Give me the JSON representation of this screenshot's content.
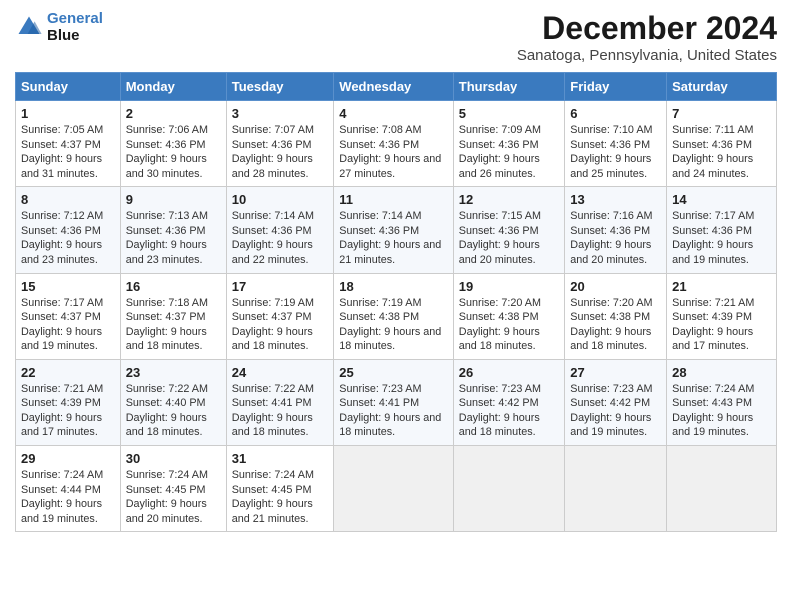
{
  "logo": {
    "line1": "General",
    "line2": "Blue"
  },
  "title": "December 2024",
  "subtitle": "Sanatoga, Pennsylvania, United States",
  "days_header": [
    "Sunday",
    "Monday",
    "Tuesday",
    "Wednesday",
    "Thursday",
    "Friday",
    "Saturday"
  ],
  "weeks": [
    [
      {
        "day": "1",
        "sunrise": "Sunrise: 7:05 AM",
        "sunset": "Sunset: 4:37 PM",
        "daylight": "Daylight: 9 hours and 31 minutes."
      },
      {
        "day": "2",
        "sunrise": "Sunrise: 7:06 AM",
        "sunset": "Sunset: 4:36 PM",
        "daylight": "Daylight: 9 hours and 30 minutes."
      },
      {
        "day": "3",
        "sunrise": "Sunrise: 7:07 AM",
        "sunset": "Sunset: 4:36 PM",
        "daylight": "Daylight: 9 hours and 28 minutes."
      },
      {
        "day": "4",
        "sunrise": "Sunrise: 7:08 AM",
        "sunset": "Sunset: 4:36 PM",
        "daylight": "Daylight: 9 hours and 27 minutes."
      },
      {
        "day": "5",
        "sunrise": "Sunrise: 7:09 AM",
        "sunset": "Sunset: 4:36 PM",
        "daylight": "Daylight: 9 hours and 26 minutes."
      },
      {
        "day": "6",
        "sunrise": "Sunrise: 7:10 AM",
        "sunset": "Sunset: 4:36 PM",
        "daylight": "Daylight: 9 hours and 25 minutes."
      },
      {
        "day": "7",
        "sunrise": "Sunrise: 7:11 AM",
        "sunset": "Sunset: 4:36 PM",
        "daylight": "Daylight: 9 hours and 24 minutes."
      }
    ],
    [
      {
        "day": "8",
        "sunrise": "Sunrise: 7:12 AM",
        "sunset": "Sunset: 4:36 PM",
        "daylight": "Daylight: 9 hours and 23 minutes."
      },
      {
        "day": "9",
        "sunrise": "Sunrise: 7:13 AM",
        "sunset": "Sunset: 4:36 PM",
        "daylight": "Daylight: 9 hours and 23 minutes."
      },
      {
        "day": "10",
        "sunrise": "Sunrise: 7:14 AM",
        "sunset": "Sunset: 4:36 PM",
        "daylight": "Daylight: 9 hours and 22 minutes."
      },
      {
        "day": "11",
        "sunrise": "Sunrise: 7:14 AM",
        "sunset": "Sunset: 4:36 PM",
        "daylight": "Daylight: 9 hours and 21 minutes."
      },
      {
        "day": "12",
        "sunrise": "Sunrise: 7:15 AM",
        "sunset": "Sunset: 4:36 PM",
        "daylight": "Daylight: 9 hours and 20 minutes."
      },
      {
        "day": "13",
        "sunrise": "Sunrise: 7:16 AM",
        "sunset": "Sunset: 4:36 PM",
        "daylight": "Daylight: 9 hours and 20 minutes."
      },
      {
        "day": "14",
        "sunrise": "Sunrise: 7:17 AM",
        "sunset": "Sunset: 4:36 PM",
        "daylight": "Daylight: 9 hours and 19 minutes."
      }
    ],
    [
      {
        "day": "15",
        "sunrise": "Sunrise: 7:17 AM",
        "sunset": "Sunset: 4:37 PM",
        "daylight": "Daylight: 9 hours and 19 minutes."
      },
      {
        "day": "16",
        "sunrise": "Sunrise: 7:18 AM",
        "sunset": "Sunset: 4:37 PM",
        "daylight": "Daylight: 9 hours and 18 minutes."
      },
      {
        "day": "17",
        "sunrise": "Sunrise: 7:19 AM",
        "sunset": "Sunset: 4:37 PM",
        "daylight": "Daylight: 9 hours and 18 minutes."
      },
      {
        "day": "18",
        "sunrise": "Sunrise: 7:19 AM",
        "sunset": "Sunset: 4:38 PM",
        "daylight": "Daylight: 9 hours and 18 minutes."
      },
      {
        "day": "19",
        "sunrise": "Sunrise: 7:20 AM",
        "sunset": "Sunset: 4:38 PM",
        "daylight": "Daylight: 9 hours and 18 minutes."
      },
      {
        "day": "20",
        "sunrise": "Sunrise: 7:20 AM",
        "sunset": "Sunset: 4:38 PM",
        "daylight": "Daylight: 9 hours and 18 minutes."
      },
      {
        "day": "21",
        "sunrise": "Sunrise: 7:21 AM",
        "sunset": "Sunset: 4:39 PM",
        "daylight": "Daylight: 9 hours and 17 minutes."
      }
    ],
    [
      {
        "day": "22",
        "sunrise": "Sunrise: 7:21 AM",
        "sunset": "Sunset: 4:39 PM",
        "daylight": "Daylight: 9 hours and 17 minutes."
      },
      {
        "day": "23",
        "sunrise": "Sunrise: 7:22 AM",
        "sunset": "Sunset: 4:40 PM",
        "daylight": "Daylight: 9 hours and 18 minutes."
      },
      {
        "day": "24",
        "sunrise": "Sunrise: 7:22 AM",
        "sunset": "Sunset: 4:41 PM",
        "daylight": "Daylight: 9 hours and 18 minutes."
      },
      {
        "day": "25",
        "sunrise": "Sunrise: 7:23 AM",
        "sunset": "Sunset: 4:41 PM",
        "daylight": "Daylight: 9 hours and 18 minutes."
      },
      {
        "day": "26",
        "sunrise": "Sunrise: 7:23 AM",
        "sunset": "Sunset: 4:42 PM",
        "daylight": "Daylight: 9 hours and 18 minutes."
      },
      {
        "day": "27",
        "sunrise": "Sunrise: 7:23 AM",
        "sunset": "Sunset: 4:42 PM",
        "daylight": "Daylight: 9 hours and 19 minutes."
      },
      {
        "day": "28",
        "sunrise": "Sunrise: 7:24 AM",
        "sunset": "Sunset: 4:43 PM",
        "daylight": "Daylight: 9 hours and 19 minutes."
      }
    ],
    [
      {
        "day": "29",
        "sunrise": "Sunrise: 7:24 AM",
        "sunset": "Sunset: 4:44 PM",
        "daylight": "Daylight: 9 hours and 19 minutes."
      },
      {
        "day": "30",
        "sunrise": "Sunrise: 7:24 AM",
        "sunset": "Sunset: 4:45 PM",
        "daylight": "Daylight: 9 hours and 20 minutes."
      },
      {
        "day": "31",
        "sunrise": "Sunrise: 7:24 AM",
        "sunset": "Sunset: 4:45 PM",
        "daylight": "Daylight: 9 hours and 21 minutes."
      },
      null,
      null,
      null,
      null
    ]
  ]
}
